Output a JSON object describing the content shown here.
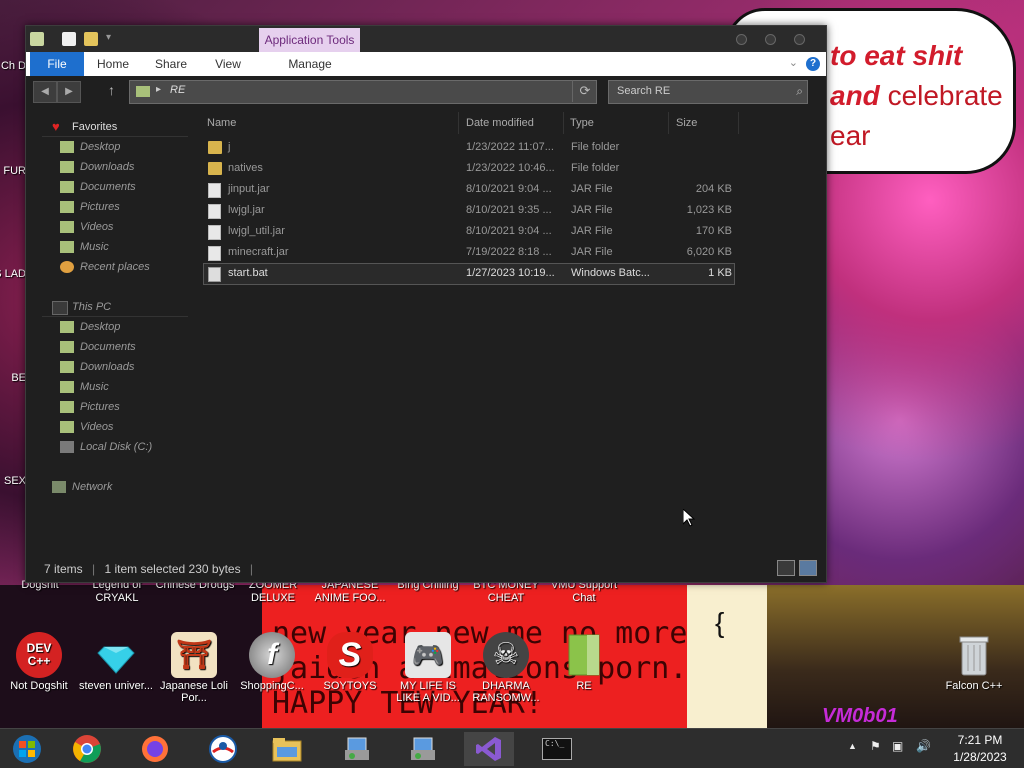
{
  "wallpaper": {
    "speech_line1": "to eat shit",
    "speech_line2a": "and",
    "speech_line2b": "celebrate",
    "speech_line3": "ear",
    "banner_line1": "new year new me no more",
    "banner_line2": "jaiden animations porn.",
    "banner_line3": "HAPPY TEW YEAR!",
    "logo": "VM0b01"
  },
  "desktop_top_labels": [
    "Dogshit",
    "Legend of CRYAKL",
    "Chinese Drougs",
    "ZOOMER DELUXE",
    "JAPANESE ANIME FOO...",
    "Bing Chilling",
    "BTC MONEY CHEAT",
    "VMU Support Chat"
  ],
  "desktop_left_partial": [
    "Ch D",
    "FUR",
    "OS LAD",
    "BE",
    "SEX"
  ],
  "desktop_icons": [
    {
      "label": "Not Dogshit",
      "icon": "devcpp-icon",
      "text": "DEV C++",
      "color": "#d42222"
    },
    {
      "label": "steven univer...",
      "icon": "diamond-icon",
      "text": "",
      "color": "#36d0e8"
    },
    {
      "label": "Japanese Loli Por...",
      "icon": "torii-icon",
      "text": "⛩",
      "color": "#f2e2c2"
    },
    {
      "label": "ShoppingC...",
      "icon": "flash-icon",
      "text": "f",
      "color": "#8a8a8a"
    },
    {
      "label": "SOYTOYS",
      "icon": "s-logo-icon",
      "text": "S",
      "color": "#e0201a"
    },
    {
      "label": "MY LIFE IS LIKE A VID...",
      "icon": "gamepad-icon",
      "text": "🎮",
      "color": "#e6e6e6"
    },
    {
      "label": "DHARMA RANSOMW...",
      "icon": "skull-icon",
      "text": "☠",
      "color": "#444"
    },
    {
      "label": "RE",
      "icon": "folder-icon",
      "text": "",
      "color": "#8bc34a"
    },
    {
      "label": "Falcon C++",
      "icon": "recycle-bin-icon",
      "text": "🗑",
      "color": "#bbbbbb"
    }
  ],
  "explorer": {
    "app_tools": "Application Tools",
    "tabs": {
      "file": "File",
      "home": "Home",
      "share": "Share",
      "view": "View",
      "manage": "Manage"
    },
    "help": "?",
    "path": "RE",
    "search_placeholder": "Search RE",
    "nav": {
      "favorites": "Favorites",
      "fav_items": [
        "Desktop",
        "Downloads",
        "Documents",
        "Pictures",
        "Videos",
        "Music",
        "Recent places"
      ],
      "this_pc": "This PC",
      "pc_items": [
        "Desktop",
        "Documents",
        "Downloads",
        "Music",
        "Pictures",
        "Videos",
        "Local Disk (C:)"
      ],
      "network": "Network"
    },
    "columns": {
      "name": "Name",
      "date": "Date modified",
      "type": "Type",
      "size": "Size"
    },
    "files": [
      {
        "name": "j",
        "date": "1/23/2022 11:07...",
        "type": "File folder",
        "size": "",
        "kind": "folder"
      },
      {
        "name": "natives",
        "date": "1/23/2022 10:46...",
        "type": "File folder",
        "size": "",
        "kind": "folder"
      },
      {
        "name": "jinput.jar",
        "date": "8/10/2021 9:04 ...",
        "type": "JAR File",
        "size": "204 KB",
        "kind": "file"
      },
      {
        "name": "lwjgl.jar",
        "date": "8/10/2021 9:35 ...",
        "type": "JAR File",
        "size": "1,023 KB",
        "kind": "file"
      },
      {
        "name": "lwjgl_util.jar",
        "date": "8/10/2021 9:04 ...",
        "type": "JAR File",
        "size": "170 KB",
        "kind": "file"
      },
      {
        "name": "minecraft.jar",
        "date": "7/19/2022 8:18 ...",
        "type": "JAR File",
        "size": "6,020 KB",
        "kind": "file"
      },
      {
        "name": "start.bat",
        "date": "1/27/2023 10:19...",
        "type": "Windows Batc...",
        "size": "1 KB",
        "kind": "bat",
        "selected": true
      }
    ],
    "status": {
      "items": "7 items",
      "selected": "1 item selected  230 bytes"
    }
  },
  "taskbar": {
    "apps": [
      "start-icon",
      "chrome-icon",
      "firefox-icon",
      "obama-icon",
      "file-explorer-icon",
      "setup-icon",
      "installer-icon",
      "visual-studio-icon",
      "cmd-icon"
    ],
    "cmd_text": "C:\\_",
    "time": "7:21 PM",
    "date": "1/28/2023"
  }
}
